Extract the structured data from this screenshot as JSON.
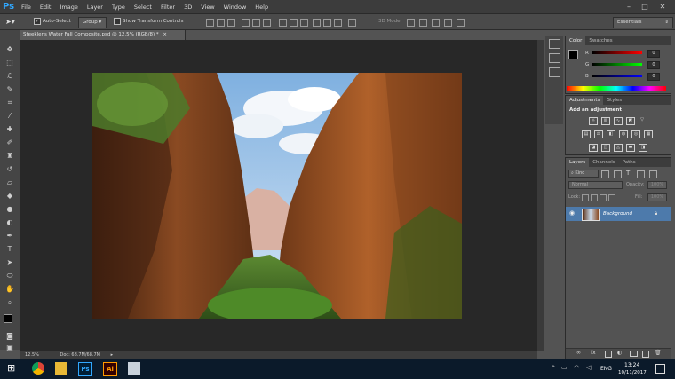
{
  "menu": {
    "logo": "Ps",
    "items": [
      "File",
      "Edit",
      "Image",
      "Layer",
      "Type",
      "Select",
      "Filter",
      "3D",
      "View",
      "Window",
      "Help"
    ]
  },
  "options": {
    "auto_select_label": "Auto-Select",
    "auto_select_checked": true,
    "group_value": "Group",
    "transform_label": "Show Transform Controls",
    "mode_3d_label": "3D Mode:",
    "workspace": "Essentials"
  },
  "document": {
    "tab_title": "Steeklens Water Fall Composite.psd @ 12.5% (RGB/8) *",
    "close_glyph": "×",
    "zoom": "12.5%",
    "doc_size": "Doc: 68.7M/68.7M"
  },
  "color_panel": {
    "tabs": [
      "Color",
      "Swatches"
    ],
    "channels": [
      {
        "label": "R",
        "value": "0"
      },
      {
        "label": "G",
        "value": "0"
      },
      {
        "label": "B",
        "value": "0"
      }
    ]
  },
  "adjustments_panel": {
    "tabs": [
      "Adjustments",
      "Styles"
    ],
    "heading": "Add an adjustment"
  },
  "layers_panel": {
    "tabs": [
      "Layers",
      "Channels",
      "Paths"
    ],
    "kind_label": "Kind",
    "blend_mode": "Normal",
    "opacity_label": "Opacity:",
    "opacity_value": "100%",
    "lock_label": "Lock:",
    "fill_label": "Fill:",
    "fill_value": "100%",
    "layers": [
      {
        "name": "Background",
        "visible": true,
        "locked": true
      }
    ]
  },
  "taskbar": {
    "language": "ENG",
    "time": "13:24",
    "date": "10/11/2017"
  },
  "colors": {
    "accent": "#31a8ff",
    "layer_selected": "#4d7aab"
  }
}
